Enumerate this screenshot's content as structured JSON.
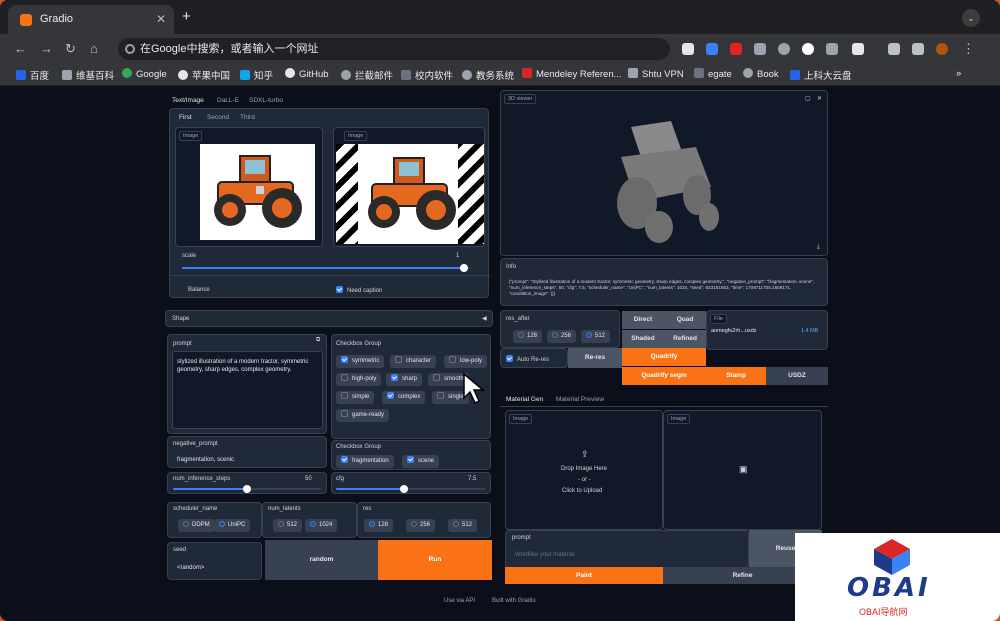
{
  "browser": {
    "tab_title": "Gradio",
    "address_placeholder": "在Google中搜索，或者输入一个网址"
  },
  "bookmarks": [
    {
      "label": "百度",
      "color": "#2563eb"
    },
    {
      "label": "维基百科",
      "color": "#9ca3af"
    },
    {
      "label": "Google",
      "color": "#34a853"
    },
    {
      "label": "苹果中国",
      "color": "#e5e7eb"
    },
    {
      "label": "知乎",
      "color": "#0ea5e9"
    },
    {
      "label": "GitHub",
      "color": "#e5e7eb"
    },
    {
      "label": "拦截邮件",
      "color": "#9ca3af"
    },
    {
      "label": "校内软件",
      "color": "#6b7280"
    },
    {
      "label": "教务系统",
      "color": "#9ca3af"
    },
    {
      "label": "Mendeley Referen...",
      "color": "#dc2626"
    },
    {
      "label": "Shtu VPN",
      "color": "#9ca3af"
    },
    {
      "label": "egate",
      "color": "#6b7280"
    },
    {
      "label": "Book",
      "color": "#9ca3af"
    },
    {
      "label": "上科大云盘",
      "color": "#2563eb"
    }
  ],
  "left_top": {
    "tabs": [
      "Text/Image",
      "DaLL-E",
      "SDXL-turbo"
    ],
    "subtabs": [
      "First",
      "Second",
      "Third"
    ],
    "image_label": "Image",
    "scale_label": "scale",
    "scale_value": "1",
    "scale_fraction": 0.98,
    "balance_label": "Balance",
    "need_caption_label": "Need caption"
  },
  "shape_label": "Shape",
  "prompt": {
    "label": "prompt",
    "value": "stylized illustration of a modern tractor, symmetric geometry, sharp edges, complex geometry."
  },
  "negative_prompt": {
    "label": "negative_prompt",
    "value": "fragmentation, scenic"
  },
  "checkbox_group": {
    "label": "Checkbox Group",
    "items": [
      {
        "label": "symmetric",
        "checked": true
      },
      {
        "label": "character",
        "checked": false
      },
      {
        "label": "low-poly",
        "checked": false
      },
      {
        "label": "high-poly",
        "checked": false
      },
      {
        "label": "sharp",
        "checked": true
      },
      {
        "label": "smooth",
        "checked": false
      },
      {
        "label": "simple",
        "checked": false
      },
      {
        "label": "complex",
        "checked": true
      },
      {
        "label": "single",
        "checked": false
      },
      {
        "label": "game-ready",
        "checked": false
      }
    ]
  },
  "checkbox_group2": {
    "label": "Checkbox Group",
    "items": [
      {
        "label": "fragmentation",
        "checked": true
      },
      {
        "label": "scene",
        "checked": true
      }
    ]
  },
  "num_inference_steps": {
    "label": "num_inference_steps",
    "value": "50",
    "fraction": 0.5
  },
  "cfg": {
    "label": "cfg",
    "value": "7.5",
    "fraction": 0.45
  },
  "scheduler_name": {
    "label": "scheduler_name",
    "options": [
      "DDPM",
      "UniPC"
    ],
    "selected": "UniPC"
  },
  "num_latents": {
    "label": "num_latents",
    "options": [
      "512",
      "1024"
    ],
    "selected": "1024"
  },
  "res": {
    "label": "res",
    "options": [
      "128",
      "256",
      "512"
    ],
    "selected": "128"
  },
  "seed": {
    "label": "seed",
    "value": "<random>"
  },
  "buttons": {
    "random": "random",
    "run": "Run"
  },
  "viewer": {
    "label": "3D viewer"
  },
  "info": {
    "label": "Info",
    "value": "{\"prompt\": \"Stylized illustration of a modern tractor, symmetric geometry, sharp edges, complex geometry.\", \"negative_prompt\": \"fragmentation, scene\", \"num_inference_steps\": 50, \"cfg\": 7.5, \"scheduler_name\": \"UniPC\", \"num_latents\": 1024, \"seed\": 823151553, \"time\": 1708711705.1509171, \"conditition_image\": {}}"
  },
  "res_after": {
    "label": "res_after",
    "options": [
      "128",
      "256",
      "512"
    ],
    "selected": "512"
  },
  "auto_rerez": {
    "label": "Auto Re-res"
  },
  "rerez_button": "Re-res",
  "mode_buttons": {
    "direct": "Direct",
    "quad": "Quad",
    "shaded": "Shaded",
    "refined": "Refined",
    "quadrify": "Quadrify",
    "quadrify_segm": "Quadrify segm",
    "stamp": "Stamp",
    "usdz": "USDZ"
  },
  "file": {
    "label": "File",
    "name": "aomegfu2rh...usdz",
    "size": "1.4 MB"
  },
  "material": {
    "tabs": [
      "Material Gen",
      "Material Preview"
    ],
    "image_label": "Image",
    "drop_text": "Drop Image Here",
    "or_text": "- or -",
    "click_text": "Click to Upload",
    "prompt_label": "prompt",
    "prompt_placeholder": "Wordlike your material",
    "reuse": "Reuse",
    "paint": "Paint",
    "refine": "Refine"
  },
  "footer": {
    "api": "Use via API",
    "built": "Built with Gradio"
  },
  "watermark": {
    "brand": "OBAI",
    "sub": "OBAI导航网"
  }
}
